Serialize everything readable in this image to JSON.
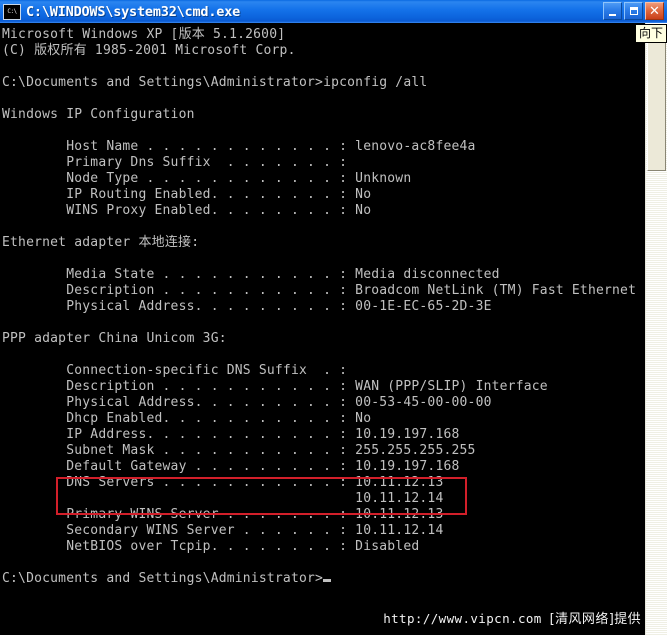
{
  "window": {
    "title": "C:\\WINDOWS\\system32\\cmd.exe",
    "icon_label": "C:\\",
    "icon_name": "cmd-console-icon",
    "buttons": {
      "minimize": "_",
      "restore": "❐",
      "close": "✕"
    }
  },
  "console": {
    "lines": [
      "Microsoft Windows XP [版本 5.1.2600]",
      "(C) 版权所有 1985-2001 Microsoft Corp.",
      "",
      "C:\\Documents and Settings\\Administrator>ipconfig /all",
      "",
      "Windows IP Configuration",
      "",
      "        Host Name . . . . . . . . . . . . : lenovo-ac8fee4a",
      "        Primary Dns Suffix  . . . . . . . :",
      "        Node Type . . . . . . . . . . . . : Unknown",
      "        IP Routing Enabled. . . . . . . . : No",
      "        WINS Proxy Enabled. . . . . . . . : No",
      "",
      "Ethernet adapter 本地连接:",
      "",
      "        Media State . . . . . . . . . . . : Media disconnected",
      "        Description . . . . . . . . . . . : Broadcom NetLink (TM) Fast Ethernet",
      "        Physical Address. . . . . . . . . : 00-1E-EC-65-2D-3E",
      "",
      "PPP adapter China Unicom 3G:",
      "",
      "        Connection-specific DNS Suffix  . :",
      "        Description . . . . . . . . . . . : WAN (PPP/SLIP) Interface",
      "        Physical Address. . . . . . . . . : 00-53-45-00-00-00",
      "        Dhcp Enabled. . . . . . . . . . . : No",
      "        IP Address. . . . . . . . . . . . : 10.19.197.168",
      "        Subnet Mask . . . . . . . . . . . : 255.255.255.255",
      "        Default Gateway . . . . . . . . . : 10.19.197.168",
      "        DNS Servers . . . . . . . . . . . : 10.11.12.13",
      "                                            10.11.12.14",
      "        Primary WINS Server . . . . . . . : 10.11.12.13",
      "        Secondary WINS Server . . . . . . : 10.11.12.14",
      "        NetBIOS over Tcpip. . . . . . . . : Disabled",
      "",
      "C:\\Documents and Settings\\Administrator>"
    ],
    "prompt_path": "C:\\Documents and Settings\\Administrator>",
    "command": "ipconfig /all",
    "host_name": "lenovo-ac8fee4a",
    "node_type": "Unknown",
    "ip_routing_enabled": "No",
    "wins_proxy_enabled": "No",
    "ethernet_adapter_name": "Ethernet adapter 本地连接:",
    "ethernet_media_state": "Media disconnected",
    "ethernet_description": "Broadcom NetLink (TM) Fast Ethernet",
    "ethernet_physical_address": "00-1E-EC-65-2D-3E",
    "ppp_adapter_name": "PPP adapter China Unicom 3G:",
    "ppp_description": "WAN (PPP/SLIP) Interface",
    "ppp_physical_address": "00-53-45-00-00-00",
    "ppp_dhcp_enabled": "No",
    "ppp_ip_address": "10.19.197.168",
    "ppp_subnet_mask": "255.255.255.255",
    "ppp_default_gateway": "10.19.197.168",
    "ppp_dns_servers": [
      "10.11.12.13",
      "10.11.12.14"
    ],
    "ppp_primary_wins": "10.11.12.13",
    "ppp_secondary_wins": "10.11.12.14",
    "ppp_netbios_over_tcpip": "Disabled"
  },
  "annotation": {
    "color": "#d21f2a",
    "target": "DNS Servers"
  },
  "scrollbar": {
    "tooltip": "向下"
  },
  "watermark": {
    "url": "http://www.vipcn.com",
    "suffix": "[清风网络]提供"
  },
  "colors": {
    "titlebar": "#1573ea",
    "console_bg": "#000000",
    "console_fg": "#c0c0c0",
    "annotation_red": "#d21f2a",
    "scrollbar_face": "#ece9d8",
    "tooltip_bg": "#ffffe1"
  }
}
